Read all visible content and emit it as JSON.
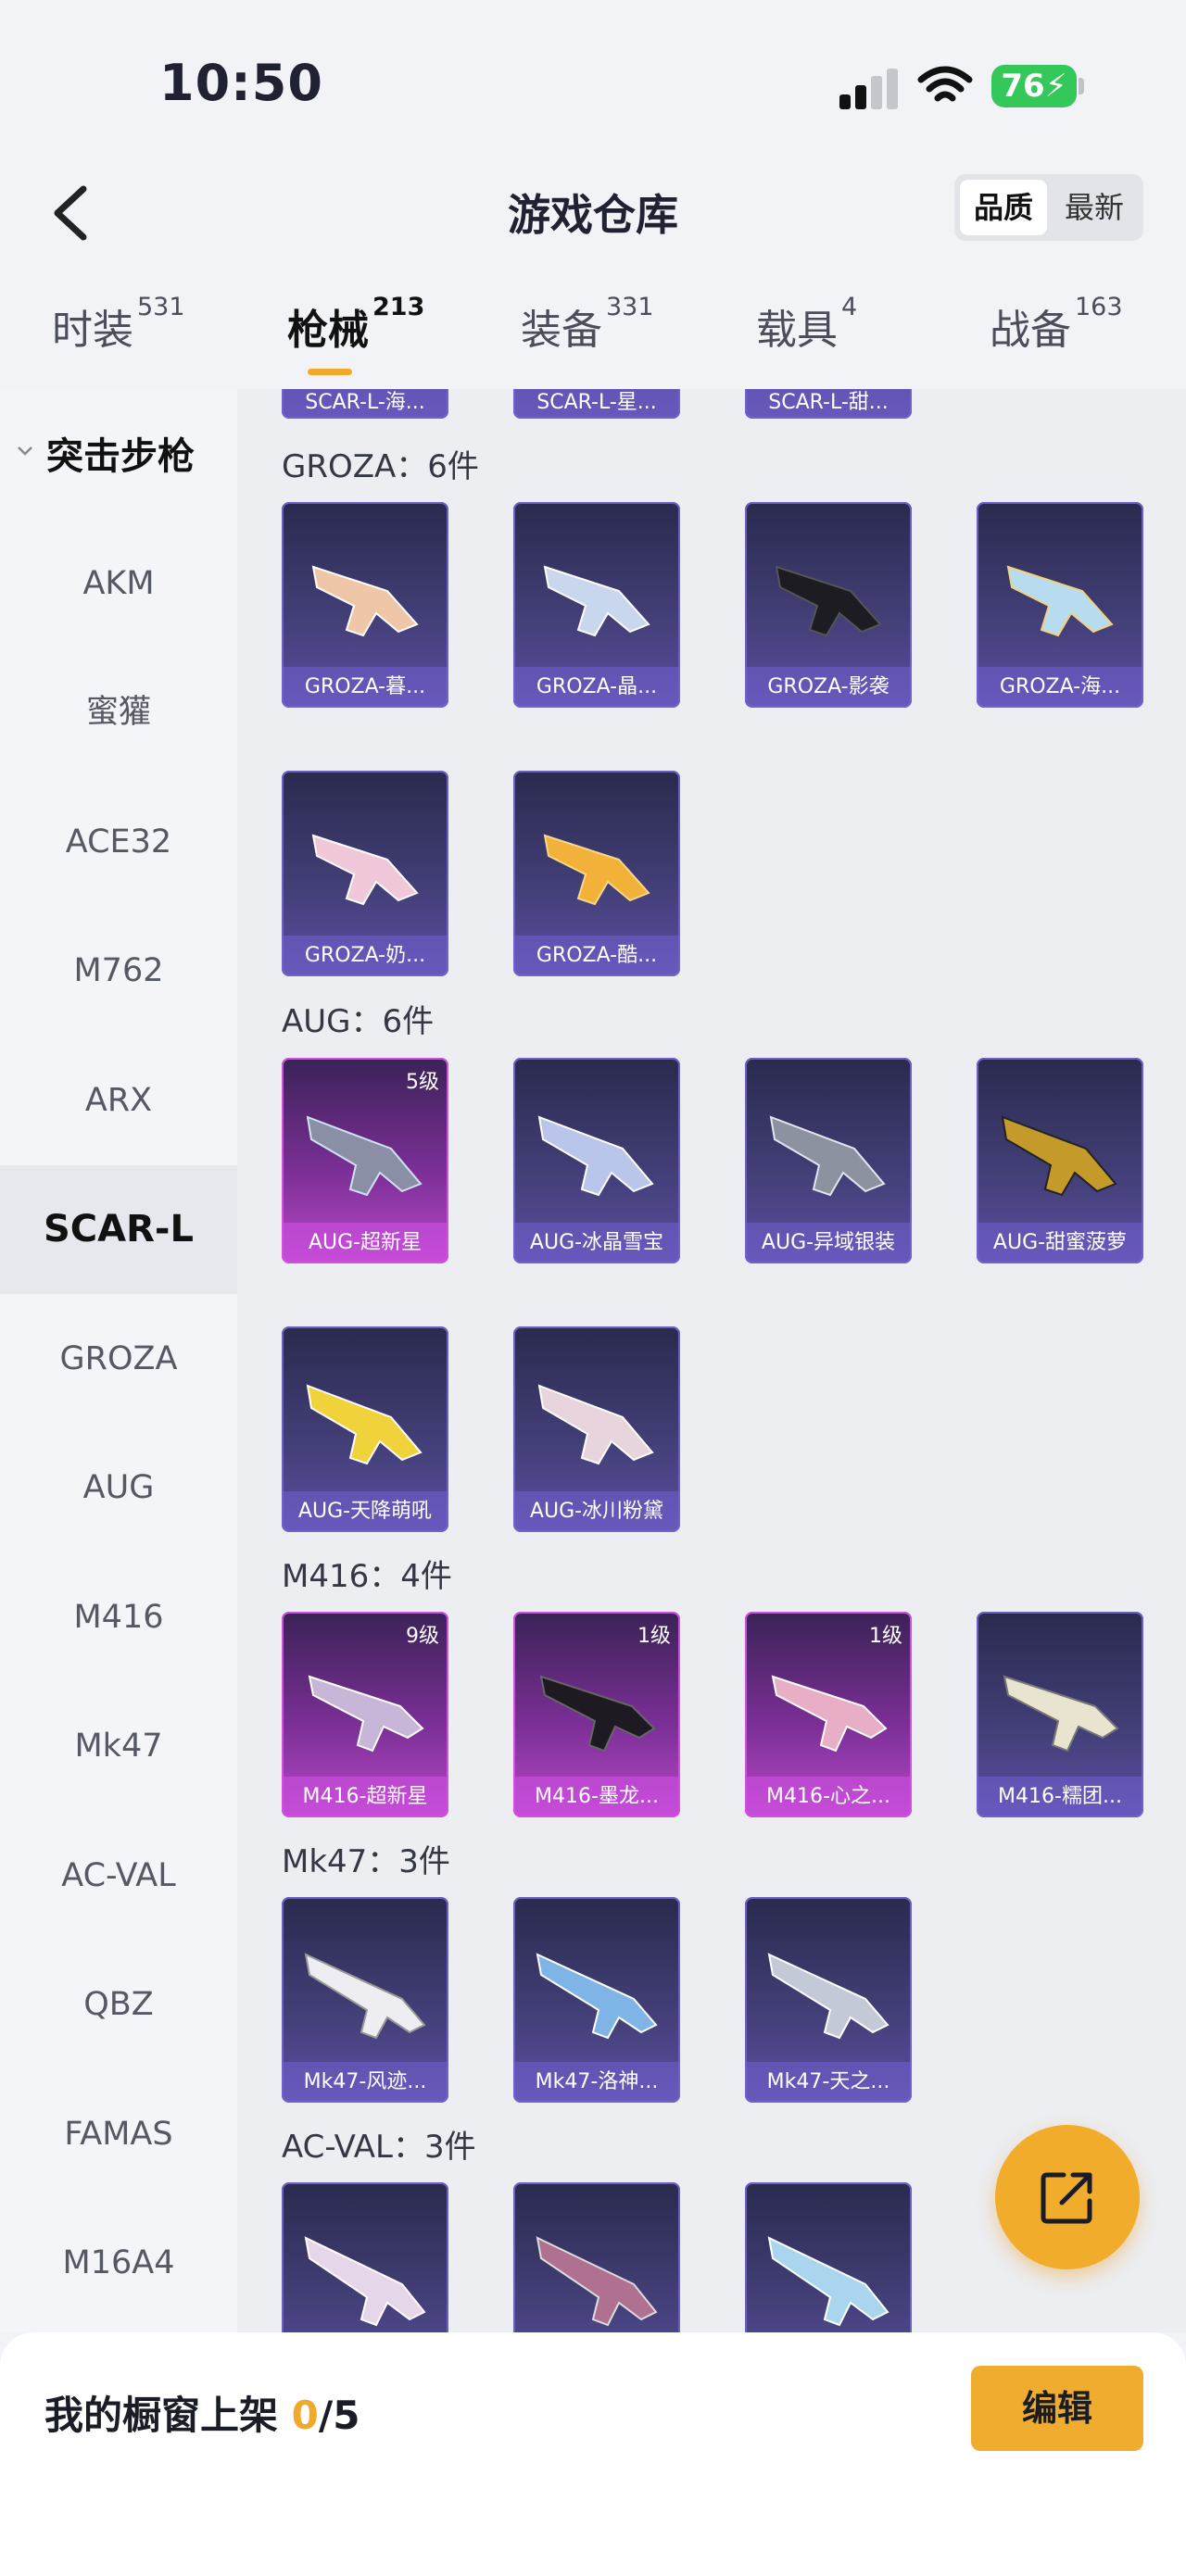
{
  "status": {
    "time": "10:50",
    "battery": "76"
  },
  "header": {
    "title": "游戏仓库",
    "sort_quality": "品质",
    "sort_newest": "最新"
  },
  "tabs": [
    {
      "label": "时装",
      "count": "531"
    },
    {
      "label": "枪械",
      "count": "213"
    },
    {
      "label": "装备",
      "count": "331"
    },
    {
      "label": "载具",
      "count": "4"
    },
    {
      "label": "战备",
      "count": "163"
    }
  ],
  "sidebar": {
    "category": "突击步枪",
    "items": [
      "AKM",
      "蜜獾",
      "ACE32",
      "M762",
      "ARX",
      "SCAR-L",
      "GROZA",
      "AUG",
      "M416",
      "Mk47",
      "AC-VAL",
      "QBZ",
      "FAMAS",
      "M16A4"
    ],
    "active": "SCAR-L"
  },
  "sections": [
    {
      "title": "GROZA：6件",
      "items": [
        {
          "label": "GROZA-暮...",
          "rarity": "normal"
        },
        {
          "label": "GROZA-晶...",
          "rarity": "normal"
        },
        {
          "label": "GROZA-影袭",
          "rarity": "normal"
        },
        {
          "label": "GROZA-海...",
          "rarity": "normal"
        },
        {
          "label": "GROZA-奶...",
          "rarity": "normal"
        },
        {
          "label": "GROZA-酷...",
          "rarity": "normal"
        }
      ]
    },
    {
      "title": "AUG：6件",
      "items": [
        {
          "label": "AUG-超新星",
          "rarity": "rare",
          "level": "5级"
        },
        {
          "label": "AUG-冰晶雪宝",
          "rarity": "normal"
        },
        {
          "label": "AUG-异域银装",
          "rarity": "normal"
        },
        {
          "label": "AUG-甜蜜菠萝",
          "rarity": "normal"
        },
        {
          "label": "AUG-天降萌吼",
          "rarity": "normal"
        },
        {
          "label": "AUG-冰川粉黛",
          "rarity": "normal"
        }
      ]
    },
    {
      "title": "M416：4件",
      "items": [
        {
          "label": "M416-超新星",
          "rarity": "rare",
          "level": "9级"
        },
        {
          "label": "M416-墨龙...",
          "rarity": "rare",
          "level": "1级"
        },
        {
          "label": "M416-心之...",
          "rarity": "rare",
          "level": "1级"
        },
        {
          "label": "M416-糯团...",
          "rarity": "normal"
        }
      ]
    },
    {
      "title": "Mk47：3件",
      "items": [
        {
          "label": "Mk47-风迹...",
          "rarity": "normal"
        },
        {
          "label": "Mk47-洛神...",
          "rarity": "normal"
        },
        {
          "label": "Mk47-天之...",
          "rarity": "normal"
        }
      ]
    },
    {
      "title": "AC-VAL：3件",
      "items": [
        {
          "label": "",
          "rarity": "normal"
        },
        {
          "label": "",
          "rarity": "normal"
        },
        {
          "label": "",
          "rarity": "normal"
        }
      ]
    }
  ],
  "top_cut": [
    "SCAR-L-海...",
    "SCAR-L-星...",
    "SCAR-L-甜..."
  ],
  "footer": {
    "text": "我的橱窗上架 ",
    "count": "0",
    "total": "/5",
    "edit": "编辑"
  },
  "colors": {
    "accent": "#f0a92a",
    "rare": "#b848c8",
    "normal": "#5b4fa3"
  }
}
